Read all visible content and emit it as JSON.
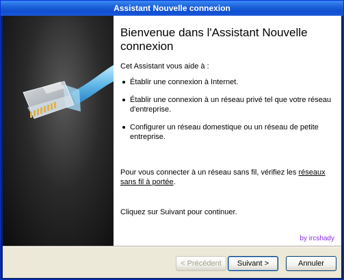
{
  "window": {
    "title": "Assistant Nouvelle connexion"
  },
  "content": {
    "heading": "Bienvenue dans l'Assistant Nouvelle connexion",
    "intro": "Cet Assistant vous aide à :",
    "bullets": [
      "Établir une connexion à Internet.",
      "Établir une connexion à un réseau privé tel que votre réseau d'entreprise.",
      "Configurer un réseau domestique ou un réseau de petite entreprise."
    ],
    "wireless_prefix": "Pour vous connecter à un réseau sans fil, vérifiez les",
    "wireless_link": "réseaux sans fil à portée",
    "wireless_suffix": ".",
    "continue_text": "Cliquez sur Suivant pour continuer.",
    "credit": "by ircshady"
  },
  "buttons": {
    "back": "< Précédent",
    "next": "Suivant >",
    "cancel": "Annuler"
  },
  "banner": {
    "image": "ethernet-cable-icon"
  },
  "colors": {
    "title_bar": "#1e62d8",
    "dialog_bg": "#ece9d8",
    "credit": "#8a2be2"
  }
}
